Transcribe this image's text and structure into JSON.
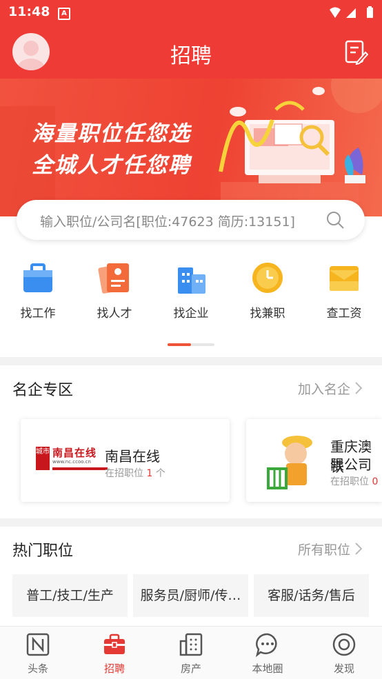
{
  "status": {
    "time": "11:48",
    "app_badge": "A"
  },
  "header": {
    "title": "招聘"
  },
  "banner": {
    "line1": "海量职位任您选",
    "line2": "全城人才任您聘"
  },
  "search": {
    "placeholder": "输入职位/公司名[职位:47623 简历:13151]"
  },
  "quick_nav": [
    {
      "label": "找工作",
      "icon": "briefcase-icon",
      "color": "#3a8ef0"
    },
    {
      "label": "找人才",
      "icon": "resume-icon",
      "color": "#f36b3a"
    },
    {
      "label": "找企业",
      "icon": "building-icon",
      "color": "#3a8ef0"
    },
    {
      "label": "找兼职",
      "icon": "clock-icon",
      "color": "#f6b41e"
    },
    {
      "label": "查工资",
      "icon": "wallet-icon",
      "color": "#f6b41e"
    }
  ],
  "famous": {
    "title": "名企专区",
    "more": "加入名企",
    "companies": [
      {
        "name": "南昌在线",
        "jobs_prefix": "在招职位",
        "jobs_count": "1",
        "jobs_suffix": "个",
        "logo_text": "南昌在线",
        "logo_sub": "www.nc.ccoo.cn",
        "logo_badge": "城市"
      },
      {
        "name_line1": "重庆澳铁",
        "name_line2": "限公司",
        "jobs_prefix": "在招职位",
        "jobs_count": "0"
      }
    ]
  },
  "hot_jobs": {
    "title": "热门职位",
    "more": "所有职位",
    "tags": [
      "普工/技工/生产",
      "服务员/厨师/传…",
      "客服/话务/售后"
    ]
  },
  "tabbar": [
    {
      "label": "头条",
      "icon": "news-icon",
      "active": false
    },
    {
      "label": "招聘",
      "icon": "recruit-icon",
      "active": true
    },
    {
      "label": "房产",
      "icon": "building-icon",
      "active": false
    },
    {
      "label": "本地圈",
      "icon": "chat-icon",
      "active": false
    },
    {
      "label": "发现",
      "icon": "eye-icon",
      "active": false
    }
  ],
  "colors": {
    "brand": "#ef3b36",
    "active_tab": "#e53935"
  }
}
